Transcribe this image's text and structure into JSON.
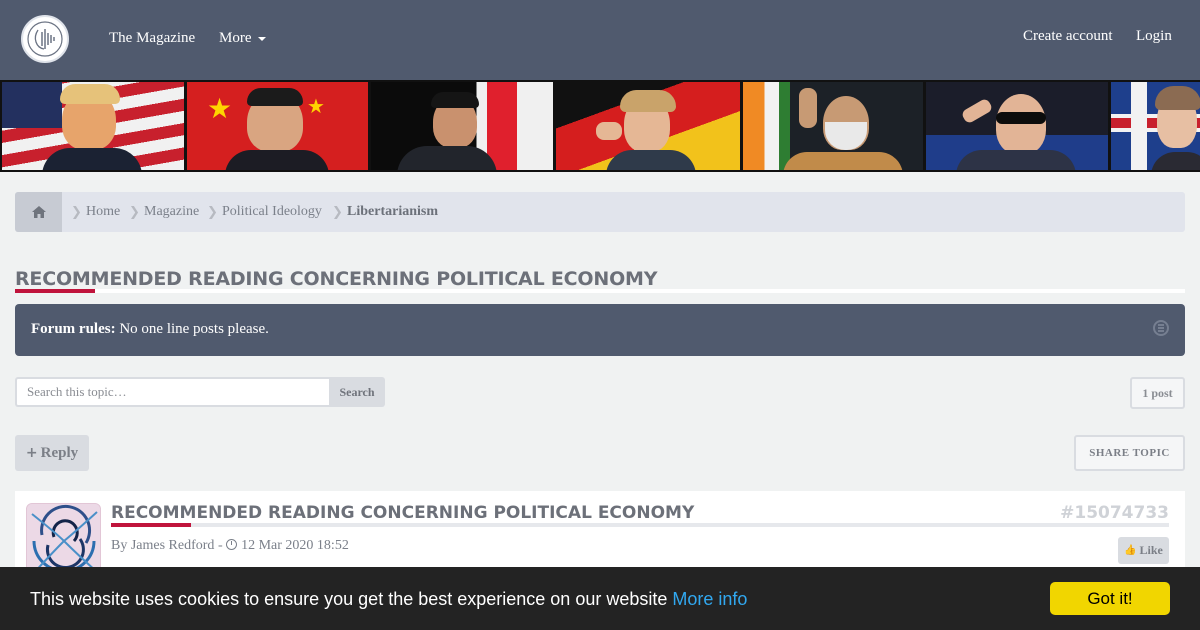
{
  "navbar": {
    "logo_icon": "brain-waveform-logo-icon",
    "links": [
      "The Magazine",
      "More"
    ],
    "create_account": "Create account",
    "login": "Login",
    "bg_color": "#505a6e"
  },
  "banner": {
    "panels": [
      "us-flag-leader",
      "china-flag-leader",
      "japan-flag-leader",
      "germany-flag-leader",
      "india-flag-leader",
      "russia-flag-leader",
      "uk-flag-leader"
    ]
  },
  "breadcrumb": {
    "home_icon": "home-icon",
    "items": [
      "Home",
      "Magazine",
      "Political Ideology",
      "Libertarianism"
    ]
  },
  "topic": {
    "title": "RECOMMENDED READING CONCERNING POLITICAL ECONOMY",
    "accent_color": "#c0143c"
  },
  "rules": {
    "label": "Forum rules:",
    "text": "No one line posts please.",
    "collapse_icon": "collapse-icon"
  },
  "search": {
    "placeholder": "Search this topic…",
    "button": "Search"
  },
  "post_count": "1 post",
  "actions": {
    "reply": "Reply",
    "share": "SHARE TOPIC"
  },
  "post": {
    "title": "RECOMMENDED READING CONCERNING POLITICAL ECONOMY",
    "id": "#15074733",
    "by": "By",
    "author": "James Redford",
    "separator": "-",
    "date": "12 Mar 2020 18:52",
    "like": "Like"
  },
  "cookie": {
    "message": "This website uses cookies to ensure you get the best experience on our website",
    "link": "More info",
    "button": "Got it!"
  }
}
